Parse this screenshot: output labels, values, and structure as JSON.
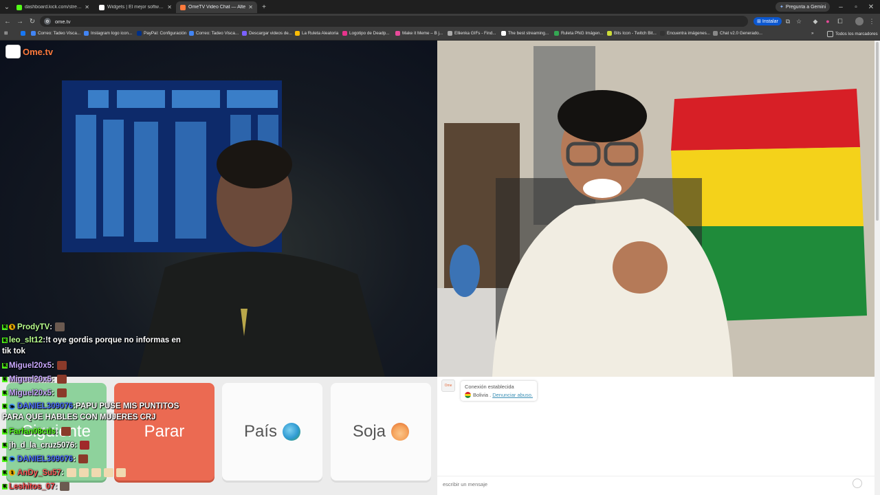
{
  "browser": {
    "tabs": [
      {
        "title": "dashboard.kick.com/stream",
        "active": false
      },
      {
        "title": "Widgets | El mejor software pa",
        "active": false
      },
      {
        "title": "OmeTV Video Chat — Alte",
        "active": true
      }
    ],
    "new_tab": "+",
    "url": "ome.tv",
    "install_label": "Instalar",
    "gemini_label": "Pregunta a Gemini",
    "bookmarks": [
      "Correo: Tadeo Visca...",
      "Instagram logo icon...",
      "PayPal: Configuración",
      "Correo: Tadeo Visca...",
      "Descargar videos de...",
      "La Ruleta Aleatoria",
      "Logotipo de Deadp...",
      "Make it Meme – B j...",
      "Ellienka GIFs - Find...",
      "The best streaming...",
      "Ruleta PNG Imágen...",
      "Bits Icon - Twitch Bit...",
      "Encuentra imágenes...",
      "Chat v2.0 Generado..."
    ],
    "all_bookmarks": "Todos los marcadores"
  },
  "site": {
    "logo": "Ome.tv"
  },
  "buttons": {
    "next": "Siguiente",
    "stop": "Parar",
    "country": "País",
    "gender": "Soja"
  },
  "chat_panel": {
    "status": "Conexión establecida",
    "country": "Bolivia",
    "report_link": "Denunciar abuso.",
    "input_placeholder": "escribir un mensaje"
  },
  "stream_chat": [
    {
      "user": "ProdyTV",
      "sep": " :",
      "text": "",
      "color": "#b9ff8e"
    },
    {
      "user": "leo_slt12",
      "sep": " :",
      "text": " !t oye gordis porque no informas en",
      "color": "#b9ff8e"
    },
    {
      "user": "",
      "sep": "",
      "text": "tik tok",
      "color": "#ffffff"
    },
    {
      "user": "Miguel20x5",
      "sep": " :",
      "text": "",
      "color": "#c9a8ff"
    },
    {
      "user": "Miguel20x5",
      "sep": " :",
      "text": "",
      "color": "#c9a8ff"
    },
    {
      "user": "Miguel20x5",
      "sep": " :",
      "text": "",
      "color": "#c9a8ff"
    },
    {
      "user": "DANIEL309076",
      "sep": " :",
      "text": " PAPU PUSE MIS PUNTITOS",
      "color": "#4c6eff"
    },
    {
      "user": "",
      "sep": "",
      "text": "PARA QUE HABLES CON MUJERES CRJ",
      "color": "#ffffff"
    },
    {
      "user": "Farfan08ctls",
      "sep": " :",
      "text": "",
      "color": "#53fc18"
    },
    {
      "user": "jh_d_la_cruz5076",
      "sep": " :",
      "text": "",
      "color": "#ffffff"
    },
    {
      "user": "DANIEL309076",
      "sep": " :",
      "text": "",
      "color": "#4c6eff"
    },
    {
      "user": "AnDy_Su57",
      "sep": " :",
      "text": "",
      "color": "#ff5a5a"
    },
    {
      "user": "Leshitos_07",
      "sep": " :",
      "text": "",
      "color": "#ff4b4b"
    }
  ]
}
